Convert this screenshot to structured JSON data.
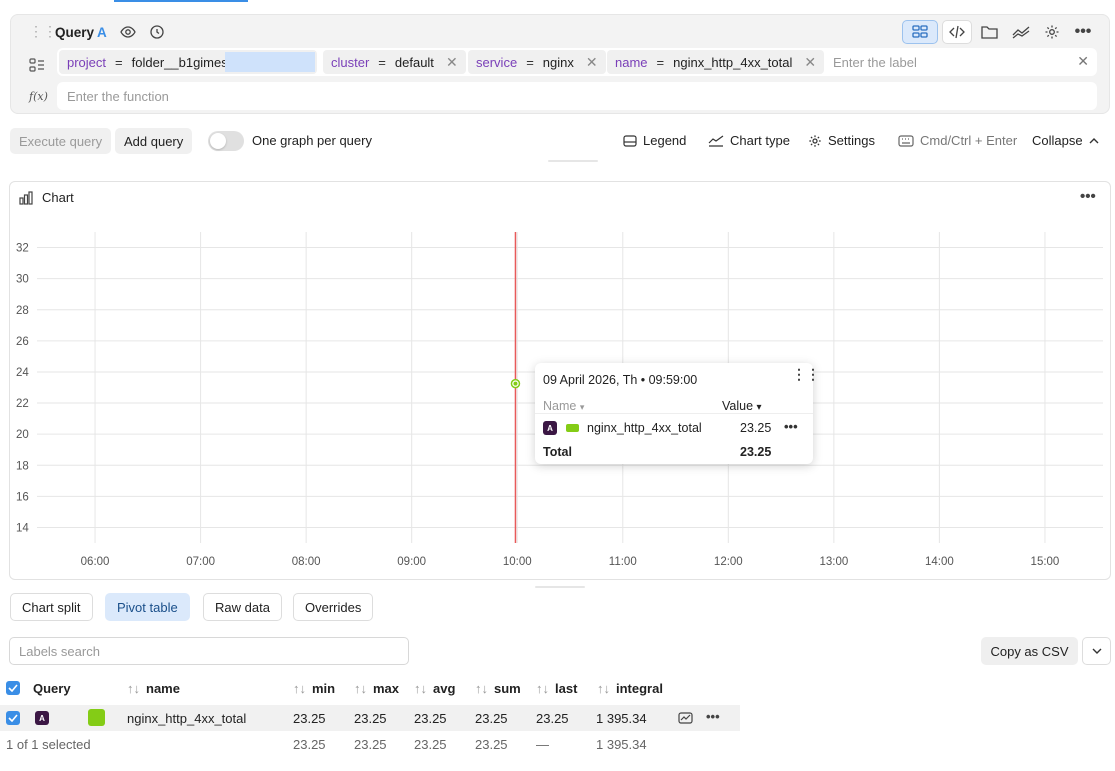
{
  "query": {
    "title": "Query",
    "letter": "A",
    "labels": [
      {
        "key": "project",
        "op": "=",
        "value": "folder__b1gimes"
      },
      {
        "key": "cluster",
        "op": "=",
        "value": "default"
      },
      {
        "key": "service",
        "op": "=",
        "value": "nginx"
      },
      {
        "key": "name",
        "op": "=",
        "value": "nginx_http_4xx_total"
      }
    ],
    "label_placeholder": "Enter the label",
    "function_placeholder": "Enter the function",
    "function_icon": "f(x)"
  },
  "toolbar": {
    "execute": "Execute query",
    "add": "Add query",
    "one_graph": "One graph per query",
    "legend": "Legend",
    "chart_type": "Chart type",
    "settings": "Settings",
    "shortcut": "Cmd/Ctrl + Enter",
    "collapse": "Collapse"
  },
  "chart": {
    "title": "Chart",
    "tooltip": {
      "datetime": "09 April 2026, Th • 09:59:00",
      "name_header": "Name",
      "value_header": "Value",
      "badge": "A",
      "series_name": "nginx_http_4xx_total",
      "series_value": "23.25",
      "total_label": "Total",
      "total_value": "23.25"
    }
  },
  "chart_data": {
    "type": "line",
    "x_ticks": [
      "06:00",
      "07:00",
      "08:00",
      "09:00",
      "10:00",
      "11:00",
      "12:00",
      "13:00",
      "14:00",
      "15:00"
    ],
    "y_ticks": [
      14,
      16,
      18,
      20,
      22,
      24,
      26,
      28,
      30,
      32
    ],
    "ylim": [
      13,
      33
    ],
    "xlim_hours": [
      5.45,
      15.55
    ],
    "grid": true,
    "series": [
      {
        "name": "nginx_http_4xx_total",
        "color": "#84cc16",
        "points": [
          {
            "x": 9.9833,
            "y": 23.25
          }
        ]
      }
    ],
    "cursor_x": 9.9833,
    "cursor_color": "#e85a5a"
  },
  "tabs": [
    "Chart split",
    "Pivot table",
    "Raw data",
    "Overrides"
  ],
  "active_tab": "Pivot table",
  "labels_search_placeholder": "Labels search",
  "copy_csv": "Copy as CSV",
  "table": {
    "headers": {
      "query": "Query",
      "name": "name",
      "min": "min",
      "max": "max",
      "avg": "avg",
      "sum": "sum",
      "last": "last",
      "integral": "integral"
    },
    "row": {
      "badge": "A",
      "color": "#84cc16",
      "name": "nginx_http_4xx_total",
      "min": "23.25",
      "max": "23.25",
      "avg": "23.25",
      "sum": "23.25",
      "last": "23.25",
      "integral": "1 395.34"
    },
    "footer": {
      "selected": "1 of 1 selected",
      "min": "23.25",
      "max": "23.25",
      "avg": "23.25",
      "sum": "23.25",
      "last": "—",
      "integral": "1 395.34"
    }
  },
  "colors": {
    "accent": "#3a8ee6",
    "series": "#84cc16",
    "cursor": "#e85a5a",
    "label_key": "#7a3fb8",
    "badge_bg": "#3b1744"
  }
}
